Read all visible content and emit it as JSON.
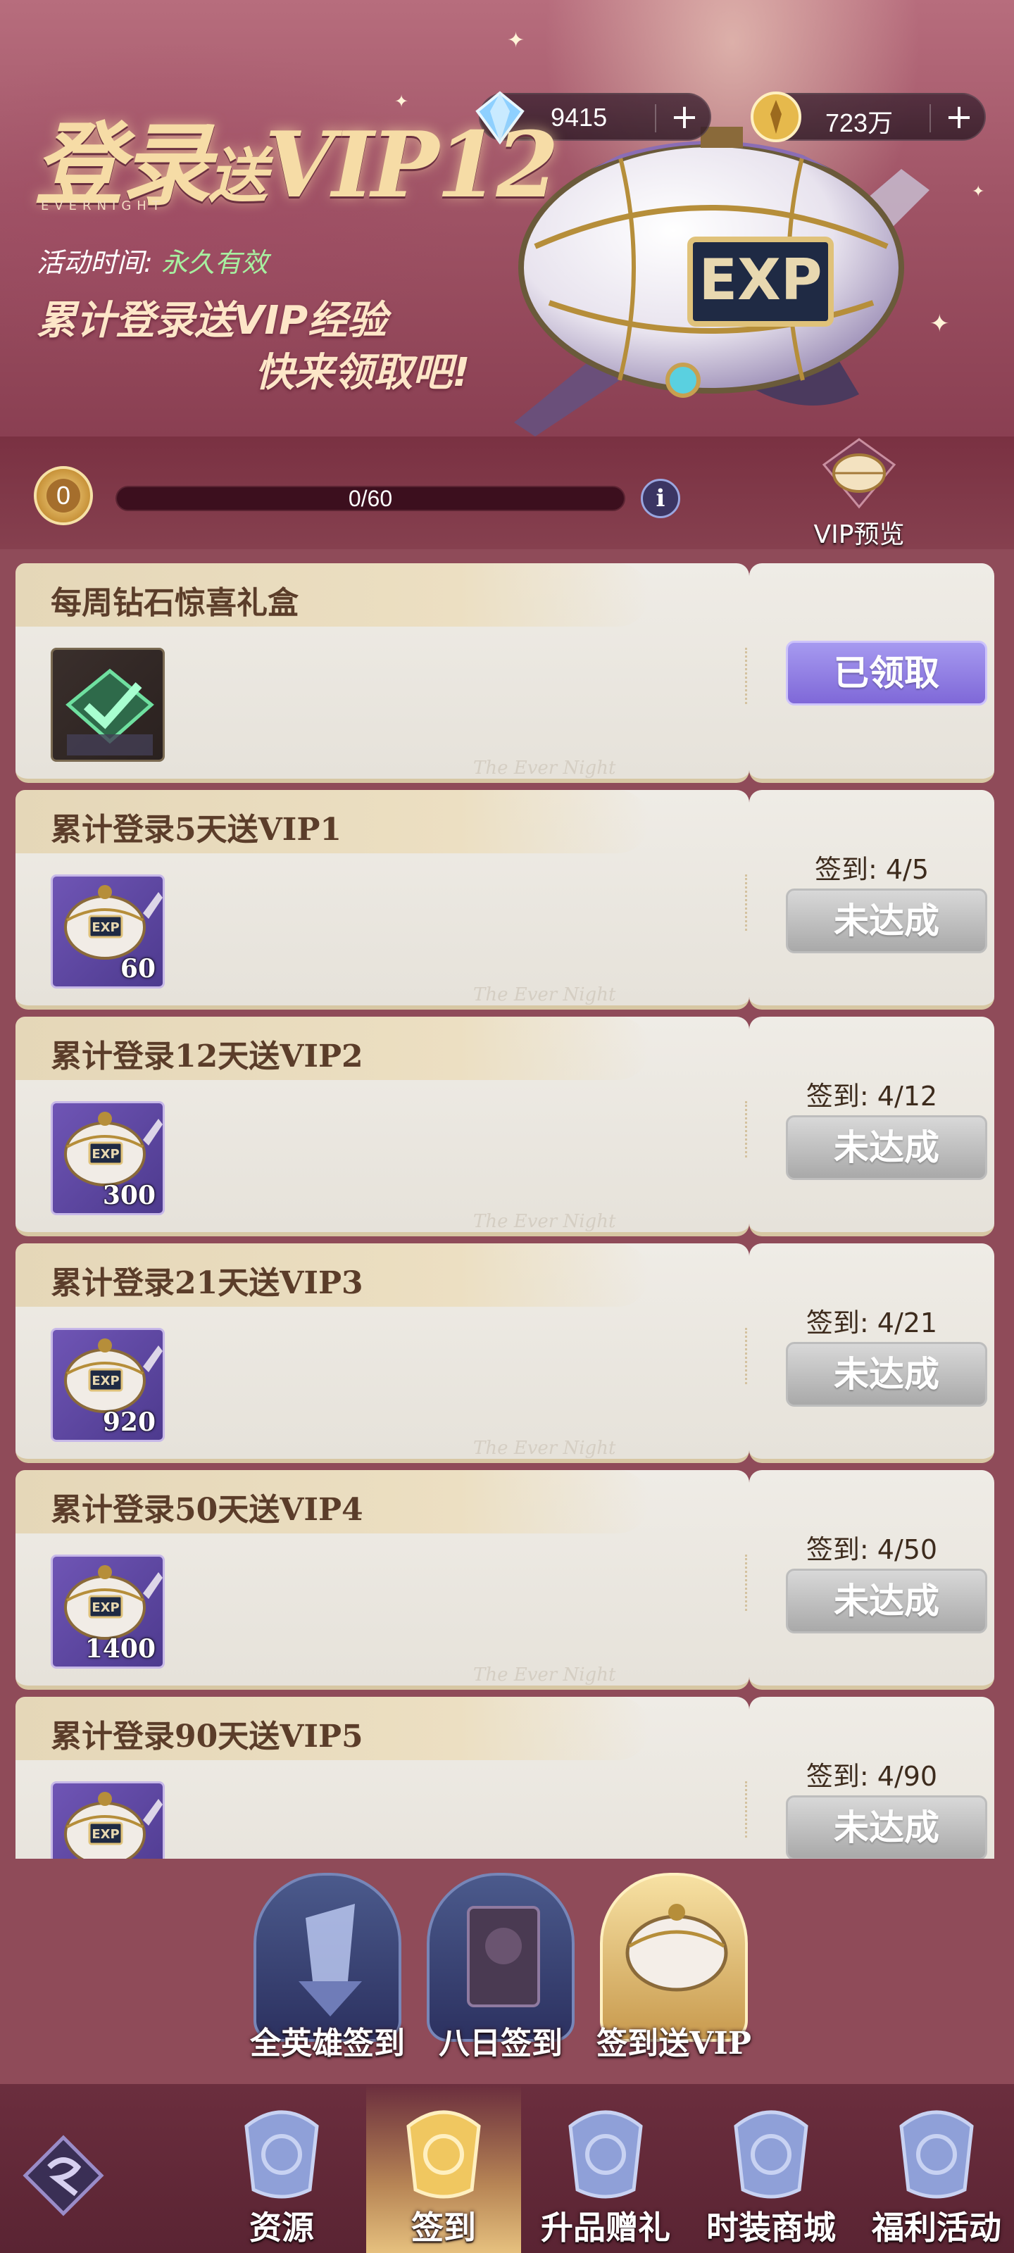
{
  "header": {
    "title_main": "登录",
    "title_small": "送",
    "title_vip": "VIP12",
    "brand": "EVERNIGHT",
    "time_label": "活动时间:",
    "time_value": "永久有效",
    "slogan_line1": "累计登录送VIP经验",
    "slogan_line2": "快来领取吧!",
    "diamonds": "9415",
    "gold": "723万",
    "colors": {
      "accent_gold": "#f6dca6",
      "green": "#a7f0a0"
    }
  },
  "progress": {
    "level": "0",
    "text": "0/60",
    "fraction": 0,
    "vip_preview_label": "VIP预览"
  },
  "cards": [
    {
      "title": "每周钻石惊喜礼盒",
      "item_icon": "check-reward-icon",
      "count": "",
      "sign_progress": "",
      "status": "已领取",
      "claimed": true,
      "watermark": "The Ever Night"
    },
    {
      "title": "累计登录5天送VIP1",
      "item_icon": "exp-airship-icon",
      "count": "60",
      "sign_progress": "签到: 4/5",
      "status": "未达成",
      "claimed": false,
      "watermark": "The Ever Night"
    },
    {
      "title": "累计登录12天送VIP2",
      "item_icon": "exp-airship-icon",
      "count": "300",
      "sign_progress": "签到: 4/12",
      "status": "未达成",
      "claimed": false,
      "watermark": "The Ever Night"
    },
    {
      "title": "累计登录21天送VIP3",
      "item_icon": "exp-airship-icon",
      "count": "920",
      "sign_progress": "签到: 4/21",
      "status": "未达成",
      "claimed": false,
      "watermark": "The Ever Night"
    },
    {
      "title": "累计登录50天送VIP4",
      "item_icon": "exp-airship-icon",
      "count": "1400",
      "sign_progress": "签到: 4/50",
      "status": "未达成",
      "claimed": false,
      "watermark": "The Ever Night"
    },
    {
      "title": "累计登录90天送VIP5",
      "item_icon": "exp-airship-icon",
      "count": "",
      "sign_progress": "签到: 4/90",
      "status": "未达成",
      "claimed": false,
      "watermark": ""
    }
  ],
  "subtabs": [
    {
      "label": "全英雄签到",
      "icon": "hero-signin-icon",
      "active": false
    },
    {
      "label": "八日签到",
      "icon": "eight-day-card-icon",
      "active": false
    },
    {
      "label": "签到送VIP",
      "icon": "airship-icon",
      "active": true
    }
  ],
  "bottom_nav": [
    {
      "label": "资源",
      "icon": "resource-icon",
      "active": false
    },
    {
      "label": "签到",
      "icon": "signin-icon",
      "active": true
    },
    {
      "label": "升品赠礼",
      "icon": "gift-box-icon",
      "active": false
    },
    {
      "label": "时装商城",
      "icon": "fashion-shop-icon",
      "active": false
    },
    {
      "label": "福利活动",
      "icon": "welfare-icon",
      "active": false
    }
  ]
}
